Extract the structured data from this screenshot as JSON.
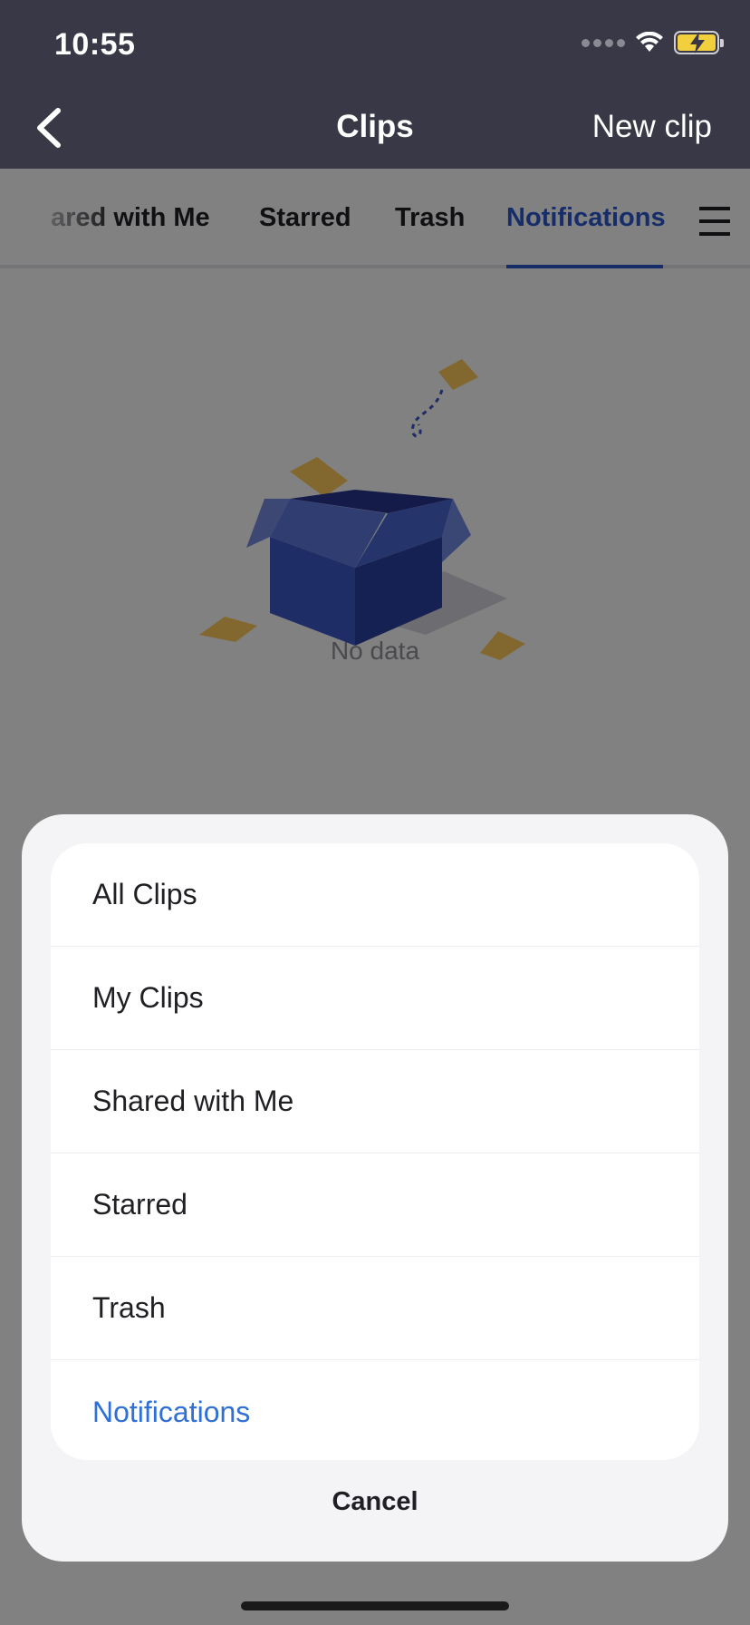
{
  "status_bar": {
    "time": "10:55"
  },
  "nav": {
    "title": "Clips",
    "new_clip_label": "New clip"
  },
  "tabs": [
    {
      "label": "Shared with Me",
      "visible_text": "ared with Me"
    },
    {
      "label": "Starred"
    },
    {
      "label": "Trash"
    },
    {
      "label": "Notifications",
      "active": true
    }
  ],
  "empty_state": {
    "text": "No data"
  },
  "action_sheet": {
    "items": [
      {
        "label": "All Clips"
      },
      {
        "label": "My Clips"
      },
      {
        "label": "Shared with Me"
      },
      {
        "label": "Starred"
      },
      {
        "label": "Trash"
      },
      {
        "label": "Notifications",
        "active": true
      }
    ],
    "cancel_label": "Cancel"
  },
  "colors": {
    "header_bg": "#383846",
    "accent": "#2a56c6",
    "active_item": "#2f6fd6",
    "box_blue": "#3c56c2",
    "paper_yellow": "#f5c45a"
  },
  "icons": [
    "chevron-left-icon",
    "hamburger-menu-icon",
    "wifi-icon",
    "battery-charging-icon",
    "empty-box-illustration"
  ]
}
